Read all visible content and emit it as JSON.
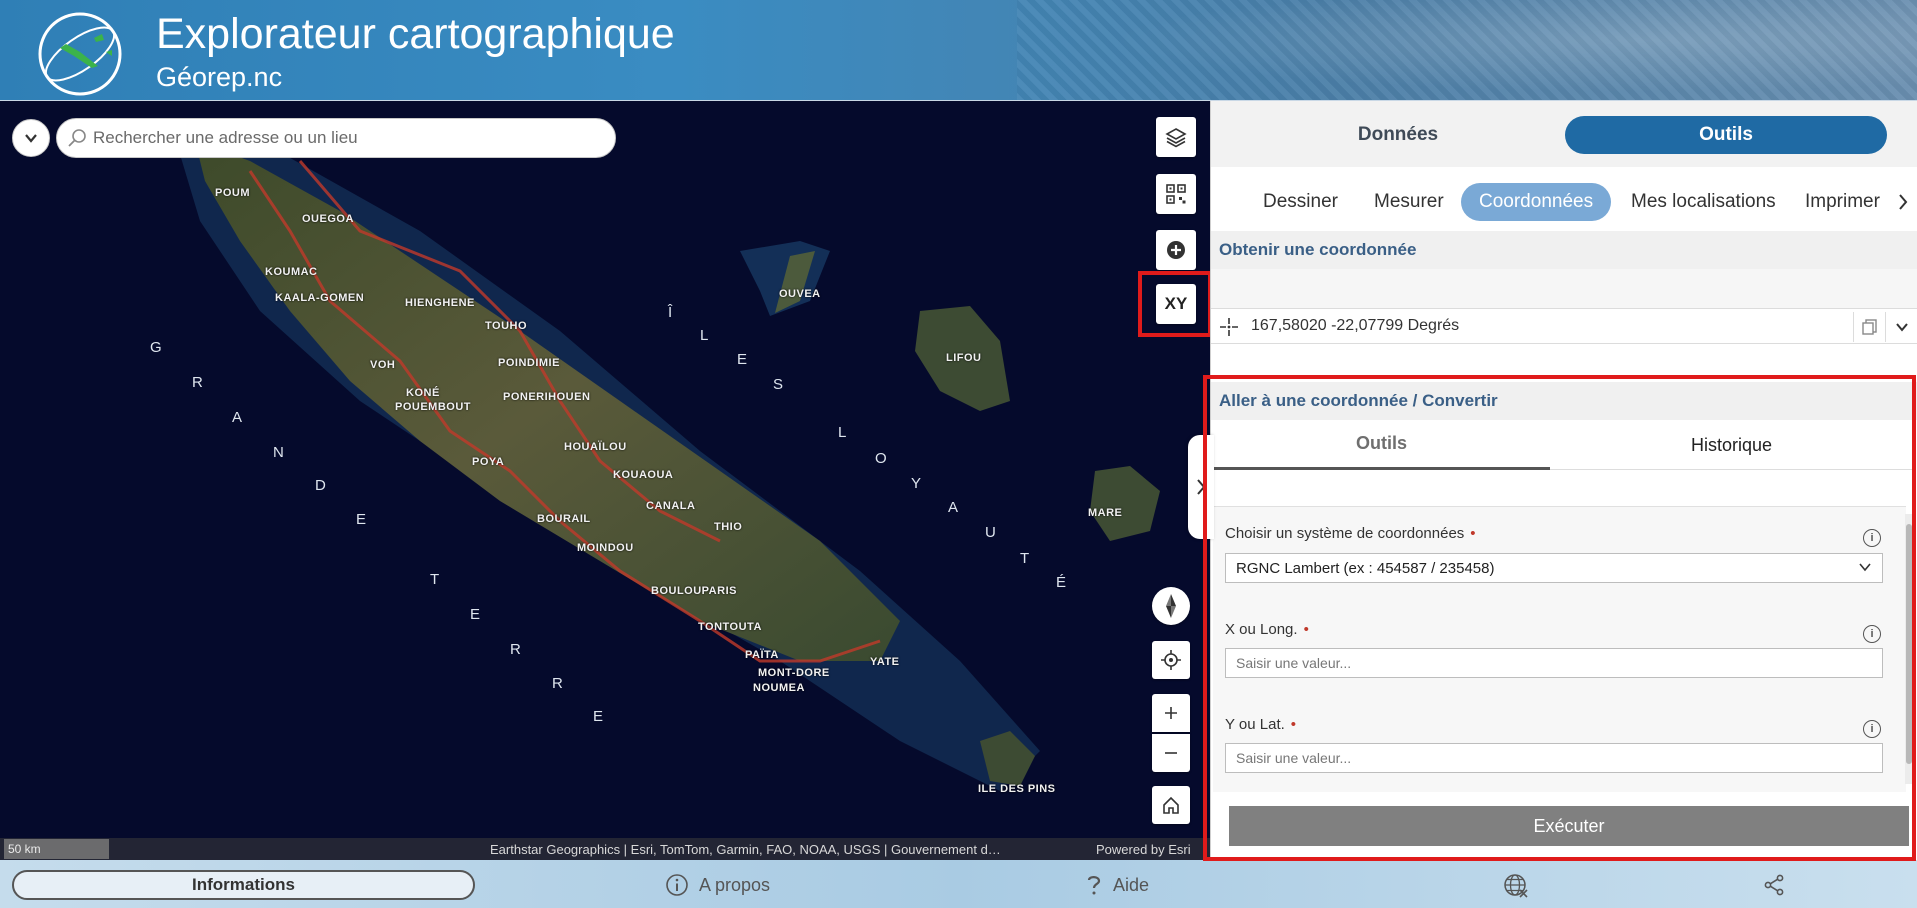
{
  "header": {
    "title": "Explorateur cartographique",
    "subtitle": "Géorep.nc"
  },
  "search": {
    "placeholder": "Rechercher une adresse ou un lieu"
  },
  "map": {
    "places": [
      "POUM",
      "OUEGOA",
      "KOUMAC",
      "KAALA-GOMEN",
      "HIENGHENE",
      "TOUHO",
      "VOH",
      "KONÉ",
      "POUEMBOUT",
      "POINDIMIE",
      "PONERIHOUEN",
      "HOUAÏLOU",
      "POYA",
      "KOUAOUA",
      "CANALA",
      "BOURAIL",
      "THIO",
      "MOINDOU",
      "BOULOUPARIS",
      "TONTOUTA",
      "PAÏTA",
      "MONT-DORE",
      "NOUMEA",
      "YATE",
      "OUVEA",
      "LIFOU",
      "MARE",
      "ILE DES PINS"
    ],
    "region_left": [
      "G",
      "R",
      "A",
      "N",
      "D",
      "E",
      "T",
      "E",
      "R",
      "R",
      "E"
    ],
    "region_right": [
      "Î",
      "L",
      "E",
      "S",
      "L",
      "O",
      "Y",
      "A",
      "U",
      "T",
      "É"
    ],
    "xy_label": "XY",
    "scale": "50 km",
    "attribution": "Earthstar Geographics | Esri, TomTom, Garmin, FAO, NOAA, USGS | Gouvernement d…",
    "powered": "Powered by Esri"
  },
  "panel": {
    "tabs": [
      "Données",
      "Outils"
    ],
    "active_tab": "Outils",
    "subtabs": [
      "Dessiner",
      "Mesurer",
      "Coordonnées",
      "Mes localisations",
      "Imprimer"
    ],
    "active_subtab": "Coordonnées",
    "get_coord": {
      "heading": "Obtenir une coordonnée",
      "value": "167,58020 -22,07799 Degrés"
    },
    "goto": {
      "heading": "Aller à une coordonnée / Convertir",
      "inner_tabs": [
        "Outils",
        "Historique"
      ],
      "system_label": "Choisir un système de coordonnées",
      "system_value": "RGNC Lambert (ex : 454587 / 235458)",
      "x_label": "X ou Long.",
      "x_placeholder": "Saisir une valeur...",
      "y_label": "Y ou Lat.",
      "y_placeholder": "Saisir une valeur...",
      "required_mark": "•",
      "execute": "Exécuter"
    }
  },
  "footer": {
    "informations": "Informations",
    "about": "A propos",
    "help": "Aide"
  },
  "colors": {
    "accent": "#1f6aa4",
    "subtab_active": "#7aa9d6",
    "highlight_frame": "#e01b1b",
    "section_heading": "#3a5f86"
  }
}
